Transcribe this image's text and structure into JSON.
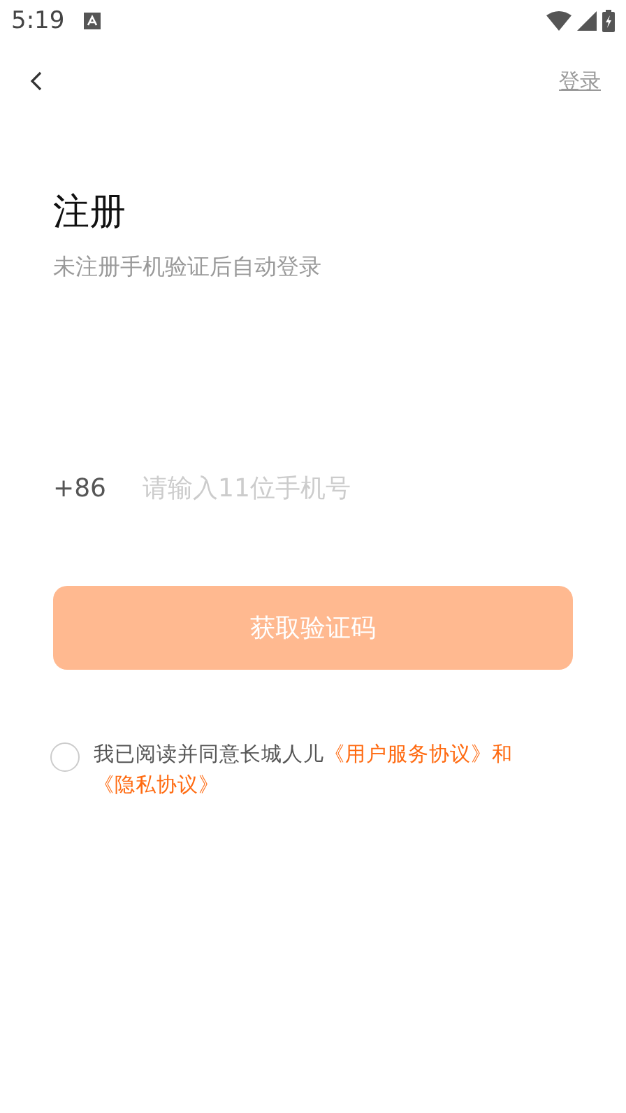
{
  "status_bar": {
    "time": "5:19"
  },
  "nav": {
    "action": "登录"
  },
  "title": "注册",
  "subtitle": "未注册手机验证后自动登录",
  "phone": {
    "prefix": "+86",
    "placeholder": "请输入11位手机号"
  },
  "submit": {
    "label": "获取验证码",
    "disabled": true
  },
  "agreement": {
    "checked": false,
    "text": "我已阅读并同意长城人儿",
    "links": [
      "《用户服务协议》",
      "《隐私协议》"
    ],
    "joiner": "和"
  }
}
